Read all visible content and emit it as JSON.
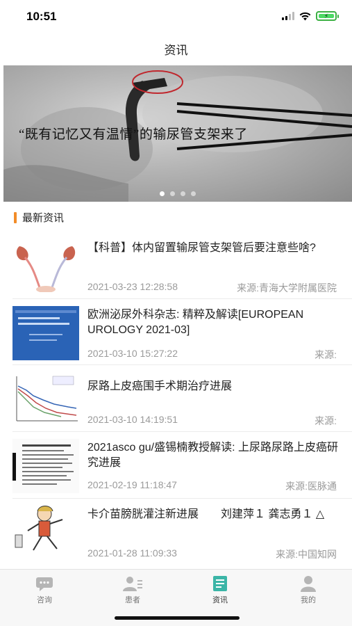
{
  "status_bar": {
    "time": "10:51"
  },
  "nav": {
    "title": "资讯"
  },
  "banner": {
    "caption": "“既有记忆又有温情”的输尿管支架来了",
    "slide_count": 4,
    "active_slide": 0
  },
  "section": {
    "title": "最新资讯"
  },
  "news": [
    {
      "title": "【科普】体内留置输尿管支架管后要注意些啥?",
      "date": "2021-03-23 12:28:58",
      "source": "来源:青海大学附属医院",
      "thumb_icon": "kidney-ureter-illustration"
    },
    {
      "title": "欧洲泌尿外科杂志: 精粹及解读[EUROPEAN UROLOGY 2021-03]",
      "date": "2021-03-10 15:27:22",
      "source": "来源:",
      "thumb_icon": "journal-cover"
    },
    {
      "title": "尿路上皮癌围手术期治疗进展",
      "date": "2021-03-10 14:19:51",
      "source": "来源:",
      "thumb_icon": "survival-chart"
    },
    {
      "title": "2021asco gu/盛锡楠教授解读: 上尿路尿路上皮癌研究进展",
      "date": "2021-02-19 11:18:47",
      "source": "来源:医脉通",
      "thumb_icon": "document-page"
    },
    {
      "title": "卡介苗膀胱灌注新进展　　刘建萍１ 龚志勇１ △",
      "date": "2021-01-28 11:09:33",
      "source": "来源:中国知网",
      "thumb_icon": "running-man-cartoon"
    }
  ],
  "tabs": [
    {
      "label": "咨询",
      "icon": "chat-icon",
      "active": false
    },
    {
      "label": "患者",
      "icon": "patients-icon",
      "active": false
    },
    {
      "label": "资讯",
      "icon": "news-icon",
      "active": true
    },
    {
      "label": "我的",
      "icon": "profile-icon",
      "active": false
    }
  ],
  "colors": {
    "accent": "#f28c28",
    "active_tab": "#3bb5a7",
    "inactive_tab": "#b5b5b5"
  }
}
